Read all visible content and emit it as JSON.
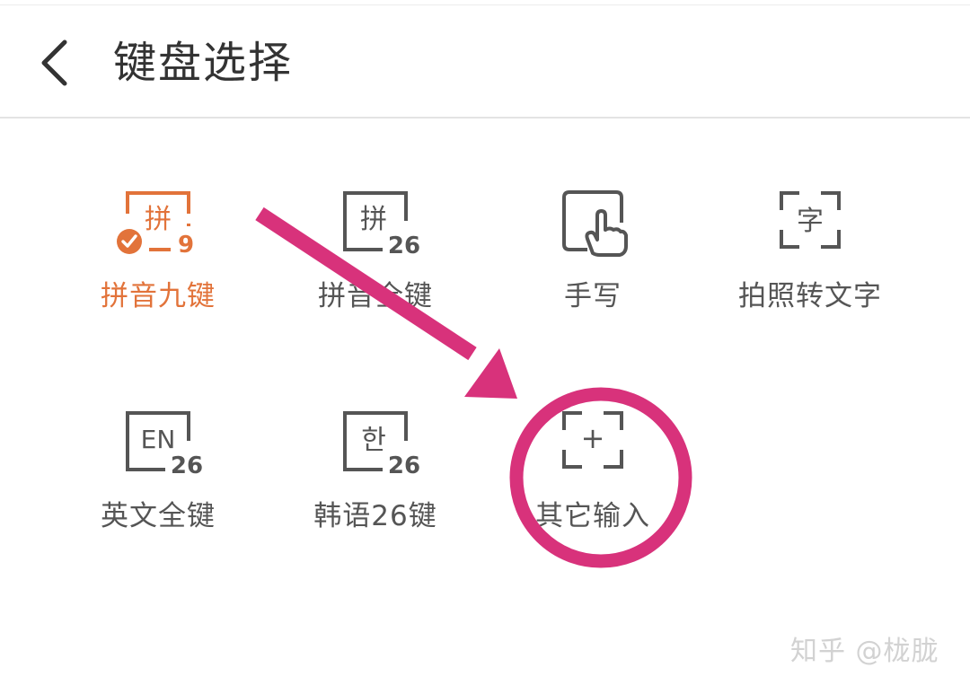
{
  "header": {
    "title": "键盘选择"
  },
  "keyboards": [
    {
      "label": "拼音九键",
      "icon_char": "拼",
      "icon_badge": "9",
      "selected": true
    },
    {
      "label": "拼音全键",
      "icon_char": "拼",
      "icon_badge": "26",
      "selected": false
    },
    {
      "label": "手写",
      "icon_char": "",
      "icon_badge": "",
      "selected": false
    },
    {
      "label": "拍照转文字",
      "icon_char": "字",
      "icon_badge": "",
      "selected": false
    },
    {
      "label": "英文全键",
      "icon_char": "EN",
      "icon_badge": "26",
      "selected": false
    },
    {
      "label": "韩语26键",
      "icon_char": "한",
      "icon_badge": "26",
      "selected": false
    },
    {
      "label": "其它输入",
      "icon_char": "+",
      "icon_badge": "",
      "selected": false
    }
  ],
  "icons": {
    "back": "chevron-left-icon",
    "pinyin9": "pinyin-nine-key-icon",
    "pinyin26": "pinyin-full-key-icon",
    "handwriting": "hand-pointer-icon",
    "photo_to_text": "scan-text-icon",
    "english": "english-keyboard-icon",
    "korean": "korean-keyboard-icon",
    "other": "add-frame-icon",
    "check": "check-badge-icon"
  },
  "watermark": {
    "text": "知乎 @栊胧"
  },
  "colors": {
    "accent": "#e2733a",
    "icon_gray": "#555555",
    "annotation": "#d8327b",
    "title": "#333333",
    "divider": "#e3e3e3",
    "watermark": "#d2d2d2"
  }
}
